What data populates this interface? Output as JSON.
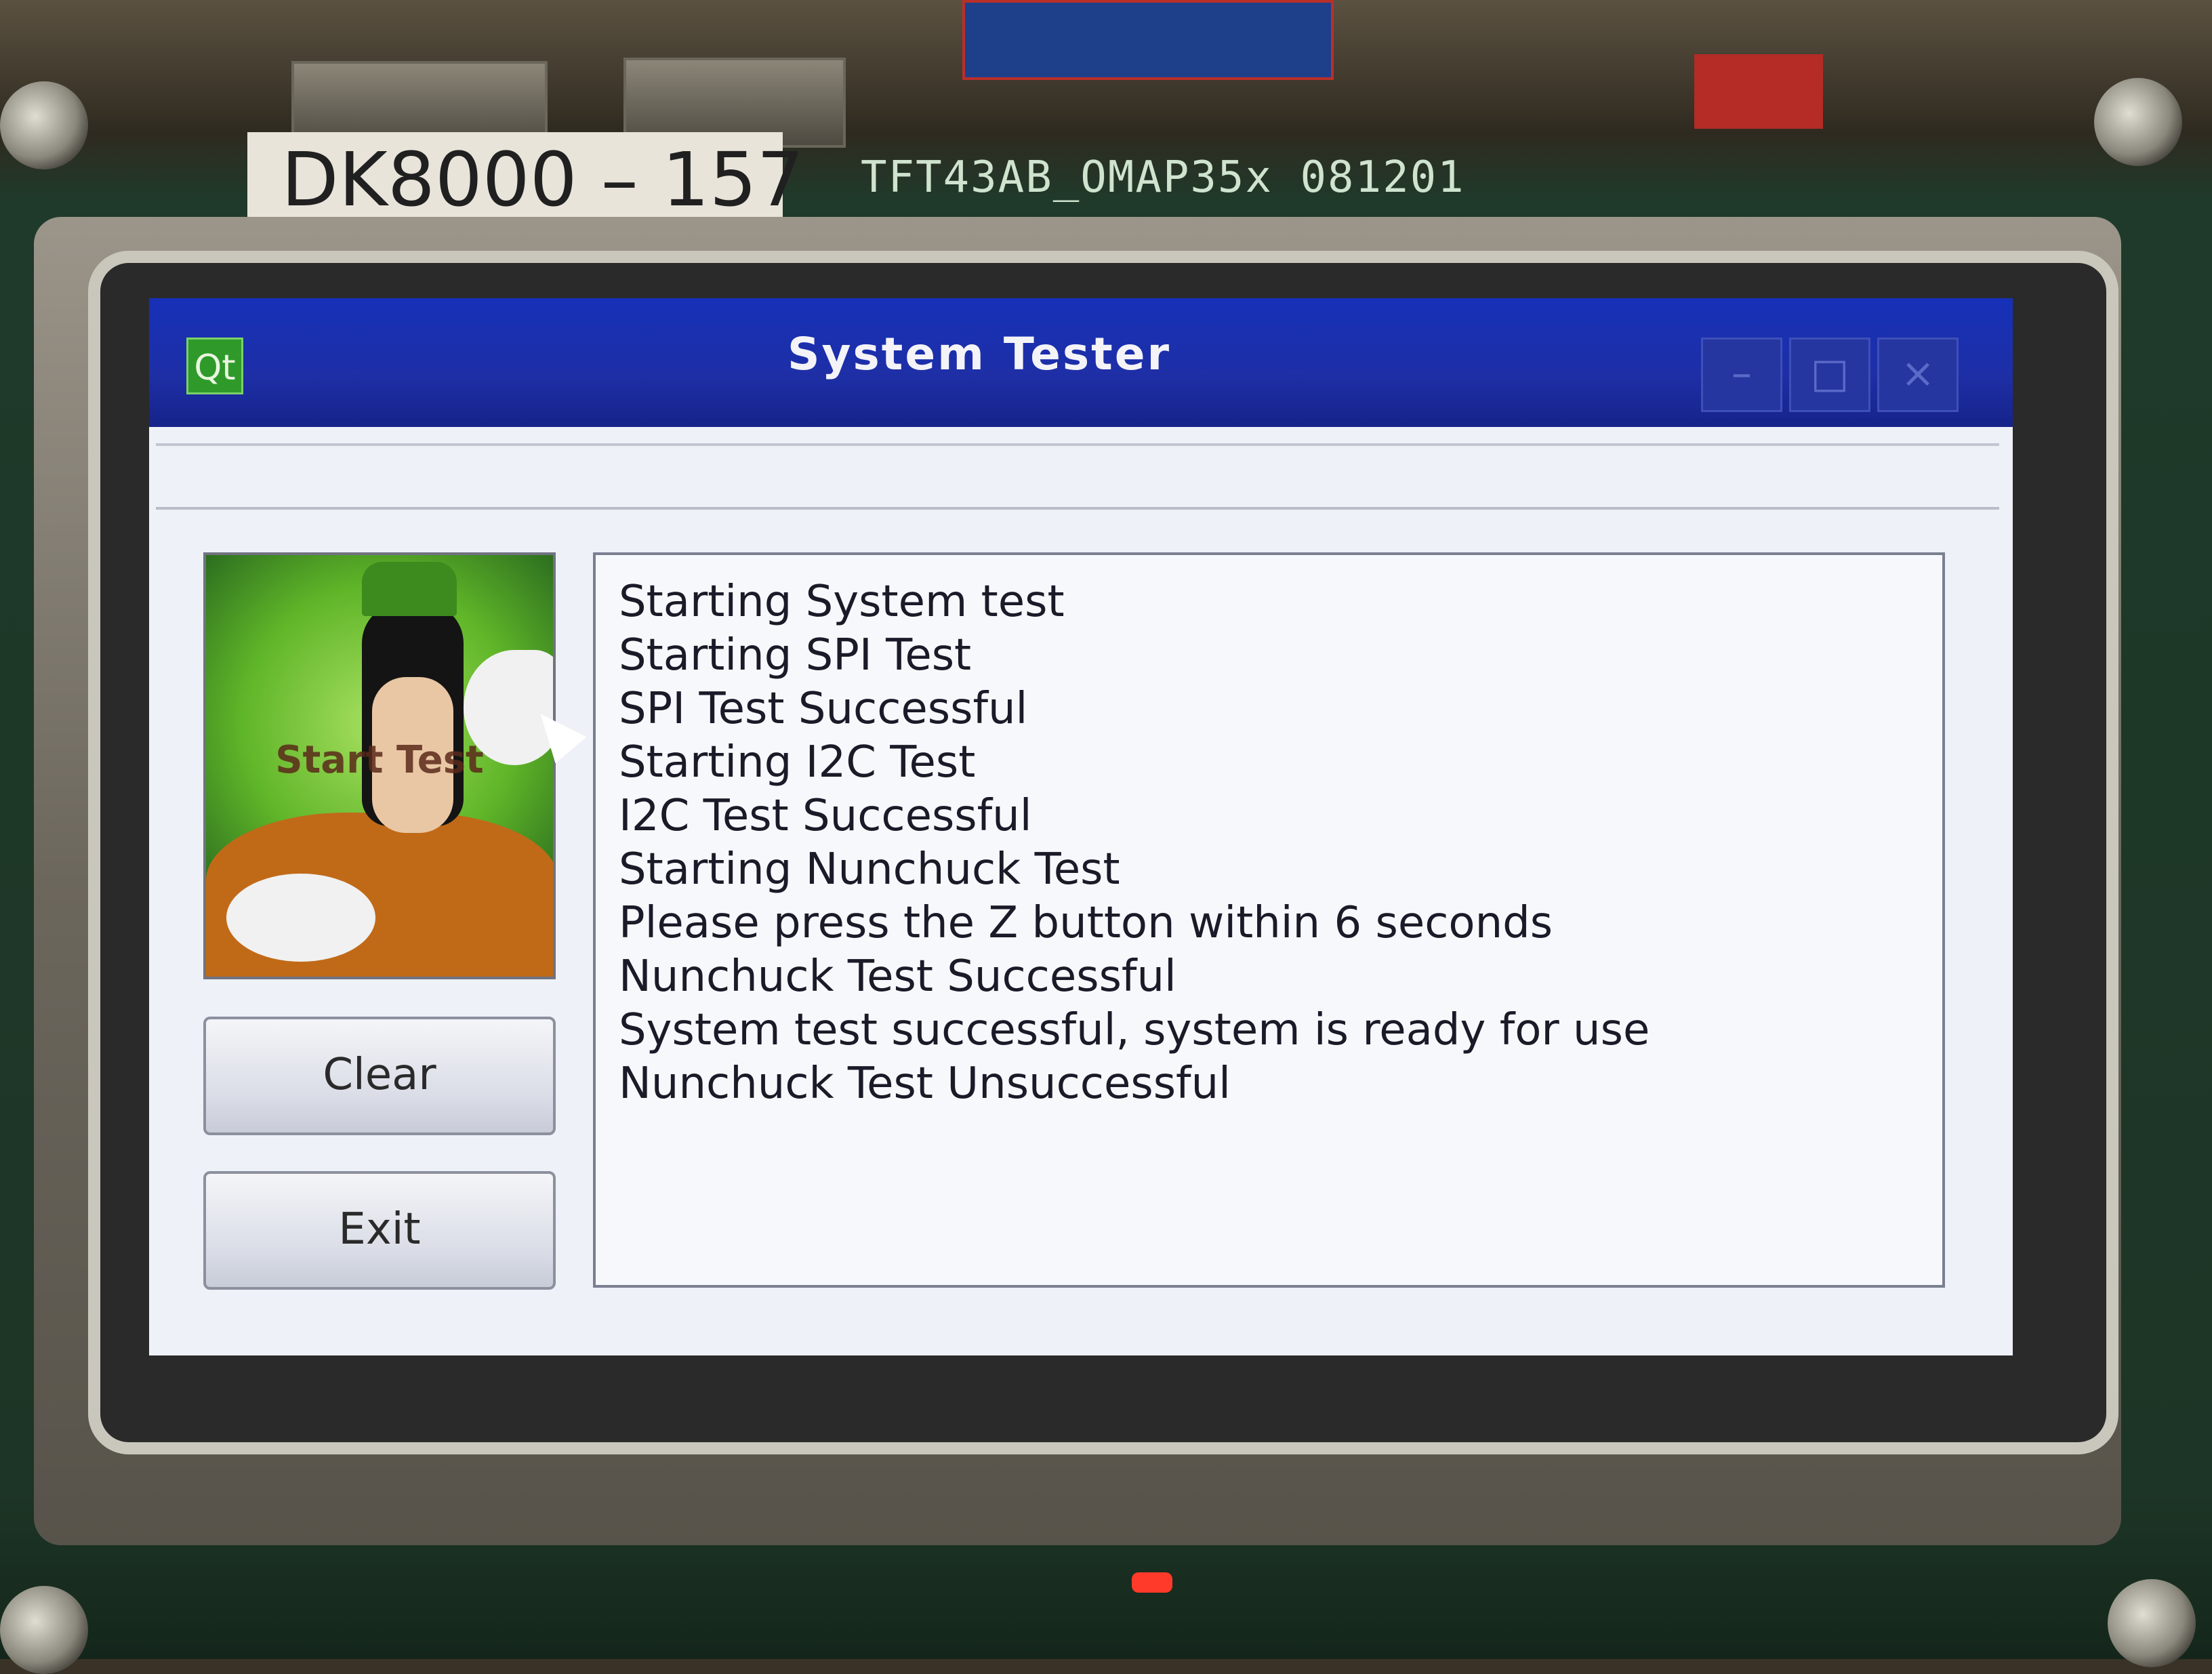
{
  "board": {
    "sticker_label": "DK8000 – 157",
    "silkscreen": "TFT43AB_OMAP35x  081201"
  },
  "window": {
    "logo_text": "Qt",
    "title": "System Tester",
    "minimize_symbol": "–",
    "maximize_symbol": "□",
    "close_symbol": "×"
  },
  "side_panel": {
    "image_caption": "Start Test",
    "clear_label": "Clear",
    "exit_label": "Exit"
  },
  "log": {
    "lines": [
      "Starting System test",
      "Starting SPI Test",
      "SPI Test Successful",
      "Starting I2C Test",
      "I2C Test Successful",
      "Starting Nunchuck Test",
      "Please press the Z button within 6 seconds",
      "Nunchuck Test Successful",
      "System test successful, system is ready for use",
      "Nunchuck Test Unsuccessful"
    ]
  },
  "colors": {
    "titlebar": "#1630b8",
    "window_bg": "#eef1f7",
    "qt_green": "#2f9a2a"
  }
}
